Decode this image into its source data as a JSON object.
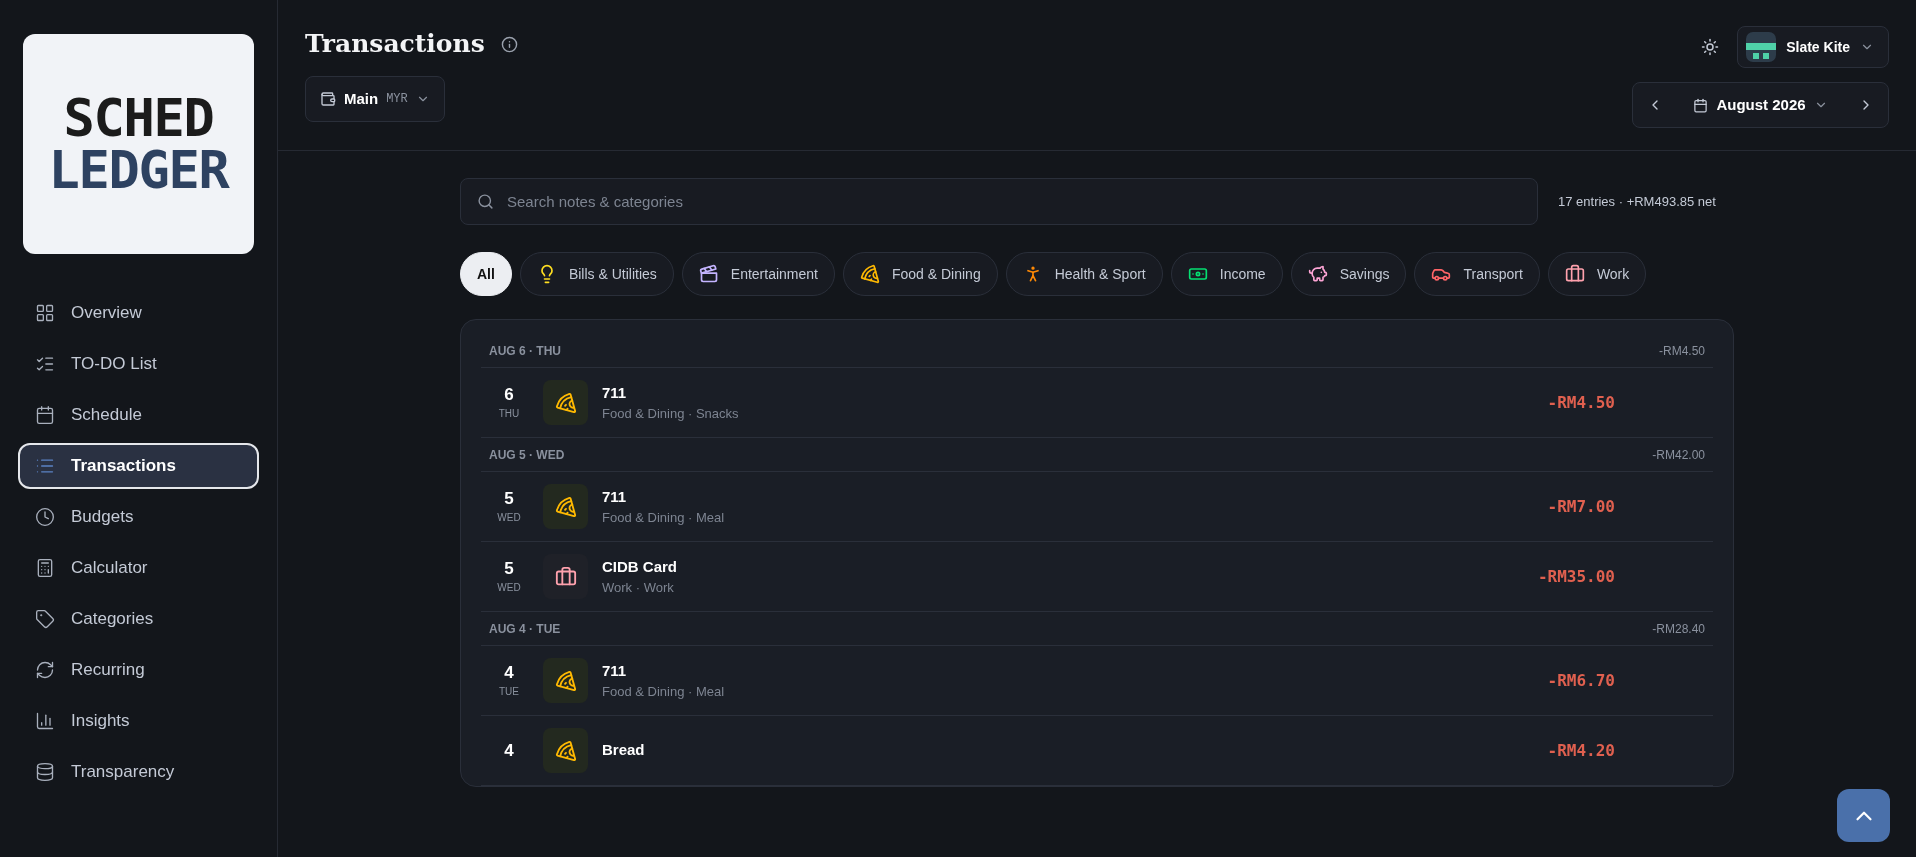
{
  "logo": {
    "line_1": "SCHED",
    "line_2": "LEDGER"
  },
  "sidebar": {
    "items": [
      {
        "label": "Overview",
        "kind": "grid",
        "selected": false
      },
      {
        "label": "TO-DO List",
        "kind": "checklist",
        "selected": false
      },
      {
        "label": "Schedule",
        "kind": "calendar",
        "selected": false
      },
      {
        "label": "Transactions",
        "kind": "list",
        "selected": true
      },
      {
        "label": "Budgets",
        "kind": "clock",
        "selected": false
      },
      {
        "label": "Calculator",
        "kind": "calculator",
        "selected": false
      },
      {
        "label": "Categories",
        "kind": "tag",
        "selected": false
      },
      {
        "label": "Recurring",
        "kind": "refresh",
        "selected": false
      },
      {
        "label": "Insights",
        "kind": "chart",
        "selected": false
      },
      {
        "label": "Transparency",
        "kind": "database",
        "selected": false
      }
    ]
  },
  "header": {
    "title": "Transactions",
    "account": {
      "name": "Main",
      "currency": "MYR"
    },
    "profile": {
      "name": "Slate Kite"
    },
    "month": "August 2026"
  },
  "search": {
    "placeholder": "Search notes & categories"
  },
  "summary": "17 entries · +RM493.85 net",
  "filters": [
    {
      "label": "All",
      "kind": "all",
      "selected": true
    },
    {
      "label": "Bills & Utilities",
      "kind": "bills",
      "selected": false
    },
    {
      "label": "Entertainment",
      "kind": "entertainment",
      "selected": false
    },
    {
      "label": "Food & Dining",
      "kind": "food",
      "selected": false
    },
    {
      "label": "Health & Sport",
      "kind": "health",
      "selected": false
    },
    {
      "label": "Income",
      "kind": "income",
      "selected": false
    },
    {
      "label": "Savings",
      "kind": "savings",
      "selected": false
    },
    {
      "label": "Transport",
      "kind": "transport",
      "selected": false
    },
    {
      "label": "Work",
      "kind": "work",
      "selected": false
    }
  ],
  "groups": [
    {
      "date": "AUG 6 · THU",
      "total": "-RM4.50",
      "rows": [
        {
          "day": "6",
          "weekday": "THU",
          "title": "711",
          "kind": "food",
          "subtitle": "Food & Dining · Snacks",
          "amount": "-RM4.50"
        }
      ]
    },
    {
      "date": "AUG 5 · WED",
      "total": "-RM42.00",
      "rows": [
        {
          "day": "5",
          "weekday": "WED",
          "title": "711",
          "kind": "food",
          "subtitle": "Food & Dining · Meal",
          "amount": "-RM7.00"
        },
        {
          "day": "5",
          "weekday": "WED",
          "title": "CIDB Card",
          "kind": "work",
          "subtitle": "Work · Work",
          "amount": "-RM35.00"
        }
      ]
    },
    {
      "date": "AUG 4 · TUE",
      "total": "-RM28.40",
      "rows": [
        {
          "day": "4",
          "weekday": "TUE",
          "title": "711",
          "kind": "food",
          "subtitle": "Food & Dining · Meal",
          "amount": "-RM6.70"
        },
        {
          "day": "4",
          "title": "Bread",
          "kind": "food",
          "amount": "-RM4.20"
        }
      ]
    }
  ]
}
